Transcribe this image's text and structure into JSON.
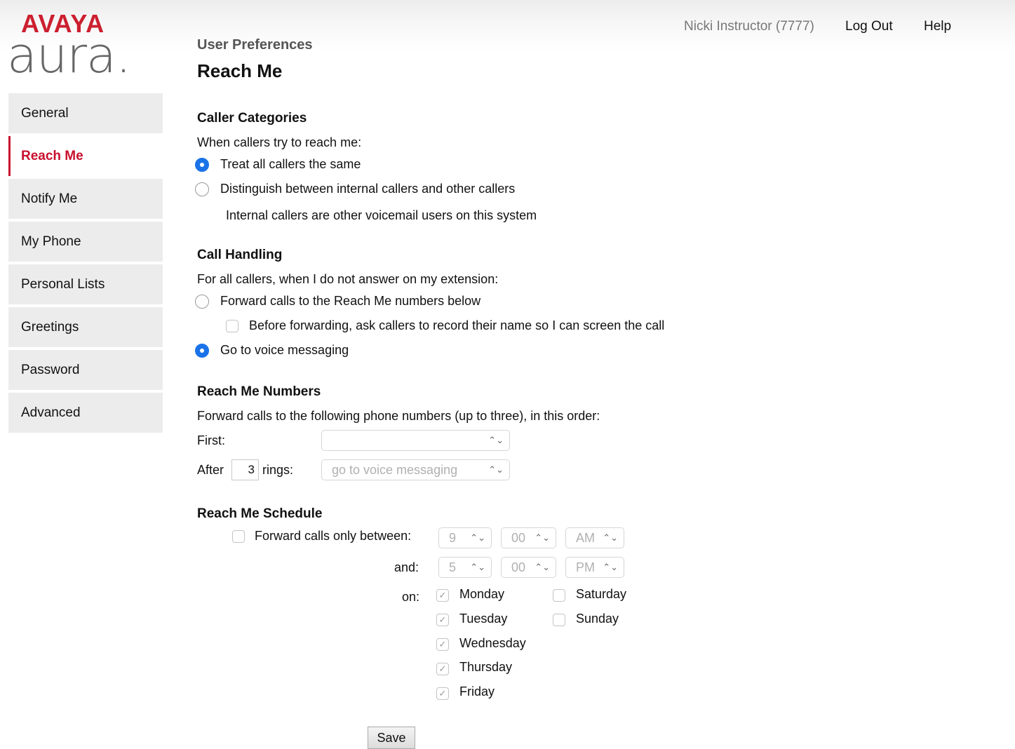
{
  "header": {
    "brand_top": "AVAYA",
    "brand_bottom": "aura.",
    "user": "Nicki Instructor (7777)",
    "logout": "Log Out",
    "help": "Help"
  },
  "sidebar": {
    "items": [
      {
        "label": "General"
      },
      {
        "label": "Reach Me"
      },
      {
        "label": "Notify Me"
      },
      {
        "label": "My Phone"
      },
      {
        "label": "Personal Lists"
      },
      {
        "label": "Greetings"
      },
      {
        "label": "Password"
      },
      {
        "label": "Advanced"
      }
    ]
  },
  "page": {
    "breadcrumb": "User Preferences",
    "title": "Reach Me"
  },
  "caller_categories": {
    "heading": "Caller Categories",
    "prompt": "When callers try to reach me:",
    "opt_same": "Treat all callers the same",
    "opt_distinguish": "Distinguish between internal callers and other callers",
    "note": "Internal callers are other voicemail users on this system"
  },
  "call_handling": {
    "heading": "Call Handling",
    "prompt": "For all callers, when I do not answer on my extension:",
    "opt_forward": "Forward calls to the Reach Me numbers below",
    "screen_label": "Before forwarding, ask callers to record their name so I can screen the call",
    "opt_voice": "Go to voice messaging"
  },
  "numbers": {
    "heading": "Reach Me Numbers",
    "prompt": "Forward calls to the following phone numbers (up to three), in this order:",
    "first_label": "First:",
    "first_value": "",
    "after_label": "After",
    "rings_value": "3",
    "rings_label": "rings:",
    "after_value": "go to voice messaging"
  },
  "schedule": {
    "heading": "Reach Me Schedule",
    "forward_label": "Forward calls only between:",
    "start_hour": "9",
    "start_min": "00",
    "start_ampm": "AM",
    "and_label": "and:",
    "end_hour": "5",
    "end_min": "00",
    "end_ampm": "PM",
    "on_label": "on:",
    "days": {
      "monday": "Monday",
      "tuesday": "Tuesday",
      "wednesday": "Wednesday",
      "thursday": "Thursday",
      "friday": "Friday",
      "saturday": "Saturday",
      "sunday": "Sunday"
    }
  },
  "save_label": "Save"
}
